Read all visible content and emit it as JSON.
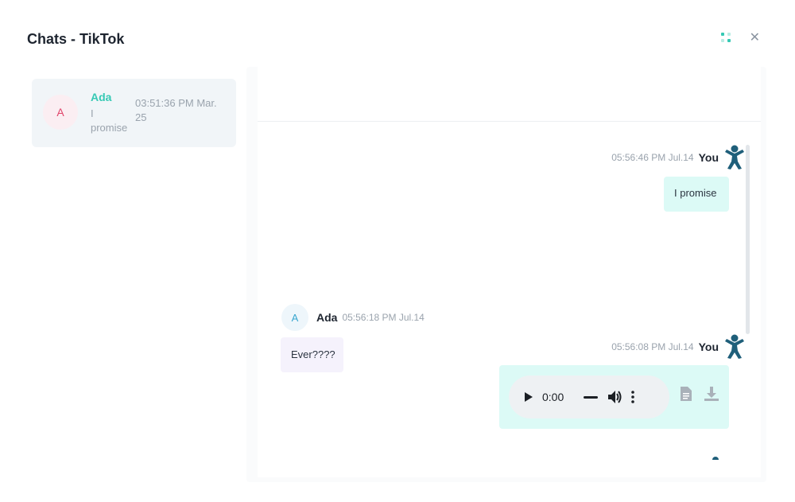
{
  "modal": {
    "title": "Chats - TikTok"
  },
  "chat_list": [
    {
      "initial": "A",
      "name": "Ada",
      "preview": "I promise",
      "time": "03:51:36 PM Mar. 25"
    }
  ],
  "messages": [
    {
      "direction": "out",
      "time": "05:56:46 PM Jul.14",
      "sender": "You",
      "text": "I promise"
    },
    {
      "direction": "in",
      "initial": "A",
      "sender": "Ada",
      "time": "05:56:18 PM Jul.14",
      "text": "Ever????"
    },
    {
      "direction": "out",
      "time": "05:56:08 PM Jul.14",
      "sender": "You",
      "audio_time": "0:00"
    }
  ],
  "colors": {
    "accent": "#36c9b4",
    "outgoing_bubble": "#dcfaf6",
    "incoming_bubble": "#f5f2fc",
    "person_icon": "#1f5f7a"
  },
  "icons": [
    "grid-icon",
    "close-icon",
    "person-icon",
    "play-icon",
    "volume-icon",
    "more-icon",
    "file-icon",
    "download-icon"
  ]
}
